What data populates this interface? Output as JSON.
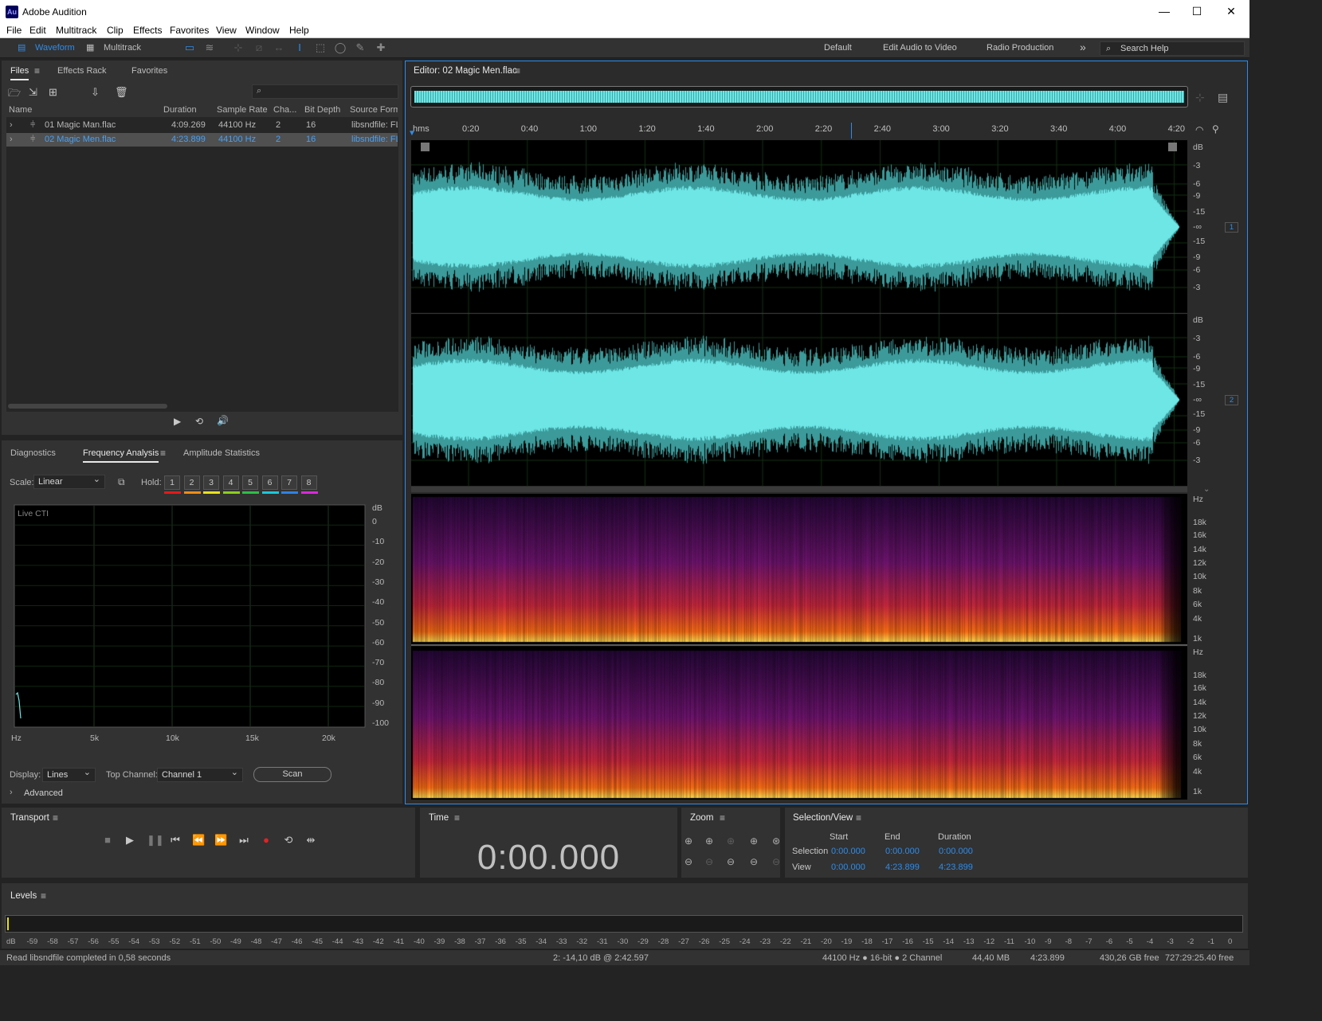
{
  "app": {
    "title": "Adobe Audition",
    "logo": "Au"
  },
  "menu": [
    "File",
    "Edit",
    "Multitrack",
    "Clip",
    "Effects",
    "Favorites",
    "View",
    "Window",
    "Help"
  ],
  "toolbar": {
    "waveform_label": "Waveform",
    "multitrack_label": "Multitrack",
    "workspaces": [
      "Default",
      "Edit Audio to Video",
      "Radio Production"
    ],
    "more": "»",
    "search_placeholder": "Search Help"
  },
  "files_panel": {
    "tabs": [
      "Files",
      "Effects Rack",
      "Favorites"
    ],
    "columns": [
      "Name",
      "Duration",
      "Sample Rate",
      "Cha...",
      "Bit Depth",
      "Source Form..."
    ],
    "rows": [
      {
        "name": "01 Magic Man.flac",
        "duration": "4:09.269",
        "rate": "44100 Hz",
        "ch": "2",
        "depth": "16",
        "src": "libsndfile: FL"
      },
      {
        "name": "02 Magic Men.flac",
        "duration": "4:23.899",
        "rate": "44100 Hz",
        "ch": "2",
        "depth": "16",
        "src": "libsndfile: FL"
      }
    ]
  },
  "analysis_panel": {
    "tabs": [
      "Diagnostics",
      "Frequency Analysis",
      "Amplitude Statistics"
    ],
    "scale_label": "Scale:",
    "scale_value": "Linear",
    "hold_label": "Hold:",
    "hold_slots": [
      "1",
      "2",
      "3",
      "4",
      "5",
      "6",
      "7",
      "8"
    ],
    "hold_colors": [
      "#e61919",
      "#f08c14",
      "#e8e11e",
      "#8ccd1e",
      "#2dbe46",
      "#19c8dc",
      "#2d82e6",
      "#dc28dc"
    ],
    "live_cti": "Live CTI",
    "db_unit": "dB",
    "db_ticks": [
      "0",
      "-10",
      "-20",
      "-30",
      "-40",
      "-50",
      "-60",
      "-70",
      "-80",
      "-90",
      "-100"
    ],
    "hz_ticks": [
      "Hz",
      "5k",
      "10k",
      "15k",
      "20k"
    ],
    "display_label": "Display:",
    "display_value": "Lines",
    "top_channel_label": "Top Channel:",
    "top_channel_value": "Channel 1",
    "scan_label": "Scan",
    "advanced_label": "Advanced"
  },
  "editor": {
    "title": "Editor: 02 Magic Men.flac",
    "ruler": [
      "hms",
      "0:20",
      "0:40",
      "1:00",
      "1:20",
      "1:40",
      "2:00",
      "2:20",
      "2:40",
      "3:00",
      "3:20",
      "3:40",
      "4:00",
      "4:20"
    ],
    "db_scale": [
      "dB",
      "-3",
      "-6",
      "-9",
      "-15",
      "-∞",
      "-15",
      "-9",
      "-6",
      "-3"
    ],
    "channels": [
      "1",
      "2"
    ],
    "hz_scale": [
      "Hz",
      "18k",
      "16k",
      "14k",
      "12k",
      "10k",
      "8k",
      "6k",
      "4k",
      "1k"
    ],
    "waveform_color": "#6ee6e6",
    "background_color": "#000000"
  },
  "transport": {
    "title": "Transport"
  },
  "time_panel": {
    "title": "Time",
    "value": "0:00.000"
  },
  "zoom_panel": {
    "title": "Zoom"
  },
  "selection_view": {
    "title": "Selection/View",
    "headers": [
      "Start",
      "End",
      "Duration"
    ],
    "rows": [
      {
        "label": "Selection",
        "start": "0:00.000",
        "end": "0:00.000",
        "duration": "0:00.000"
      },
      {
        "label": "View",
        "start": "0:00.000",
        "end": "4:23.899",
        "duration": "4:23.899"
      }
    ]
  },
  "levels": {
    "title": "Levels",
    "scale": [
      "dB",
      "-59",
      "-58",
      "-57",
      "-56",
      "-55",
      "-54",
      "-53",
      "-52",
      "-51",
      "-50",
      "-49",
      "-48",
      "-47",
      "-46",
      "-45",
      "-44",
      "-43",
      "-42",
      "-41",
      "-40",
      "-39",
      "-38",
      "-37",
      "-36",
      "-35",
      "-34",
      "-33",
      "-32",
      "-31",
      "-30",
      "-29",
      "-28",
      "-27",
      "-26",
      "-25",
      "-24",
      "-23",
      "-22",
      "-21",
      "-20",
      "-19",
      "-18",
      "-17",
      "-16",
      "-15",
      "-14",
      "-13",
      "-12",
      "-11",
      "-10",
      "-9",
      "-8",
      "-7",
      "-6",
      "-5",
      "-4",
      "-3",
      "-2",
      "-1",
      "0"
    ]
  },
  "status": {
    "message": "Read libsndfile completed in 0,58 seconds",
    "cursor": "2: -14,10 dB @ 2:42.597",
    "format": "44100 Hz ● 16-bit ● 2 Channel",
    "size": "44,40 MB",
    "duration": "4:23.899",
    "free": "430,26 GB free",
    "free_time": "727:29:25.40 free"
  }
}
